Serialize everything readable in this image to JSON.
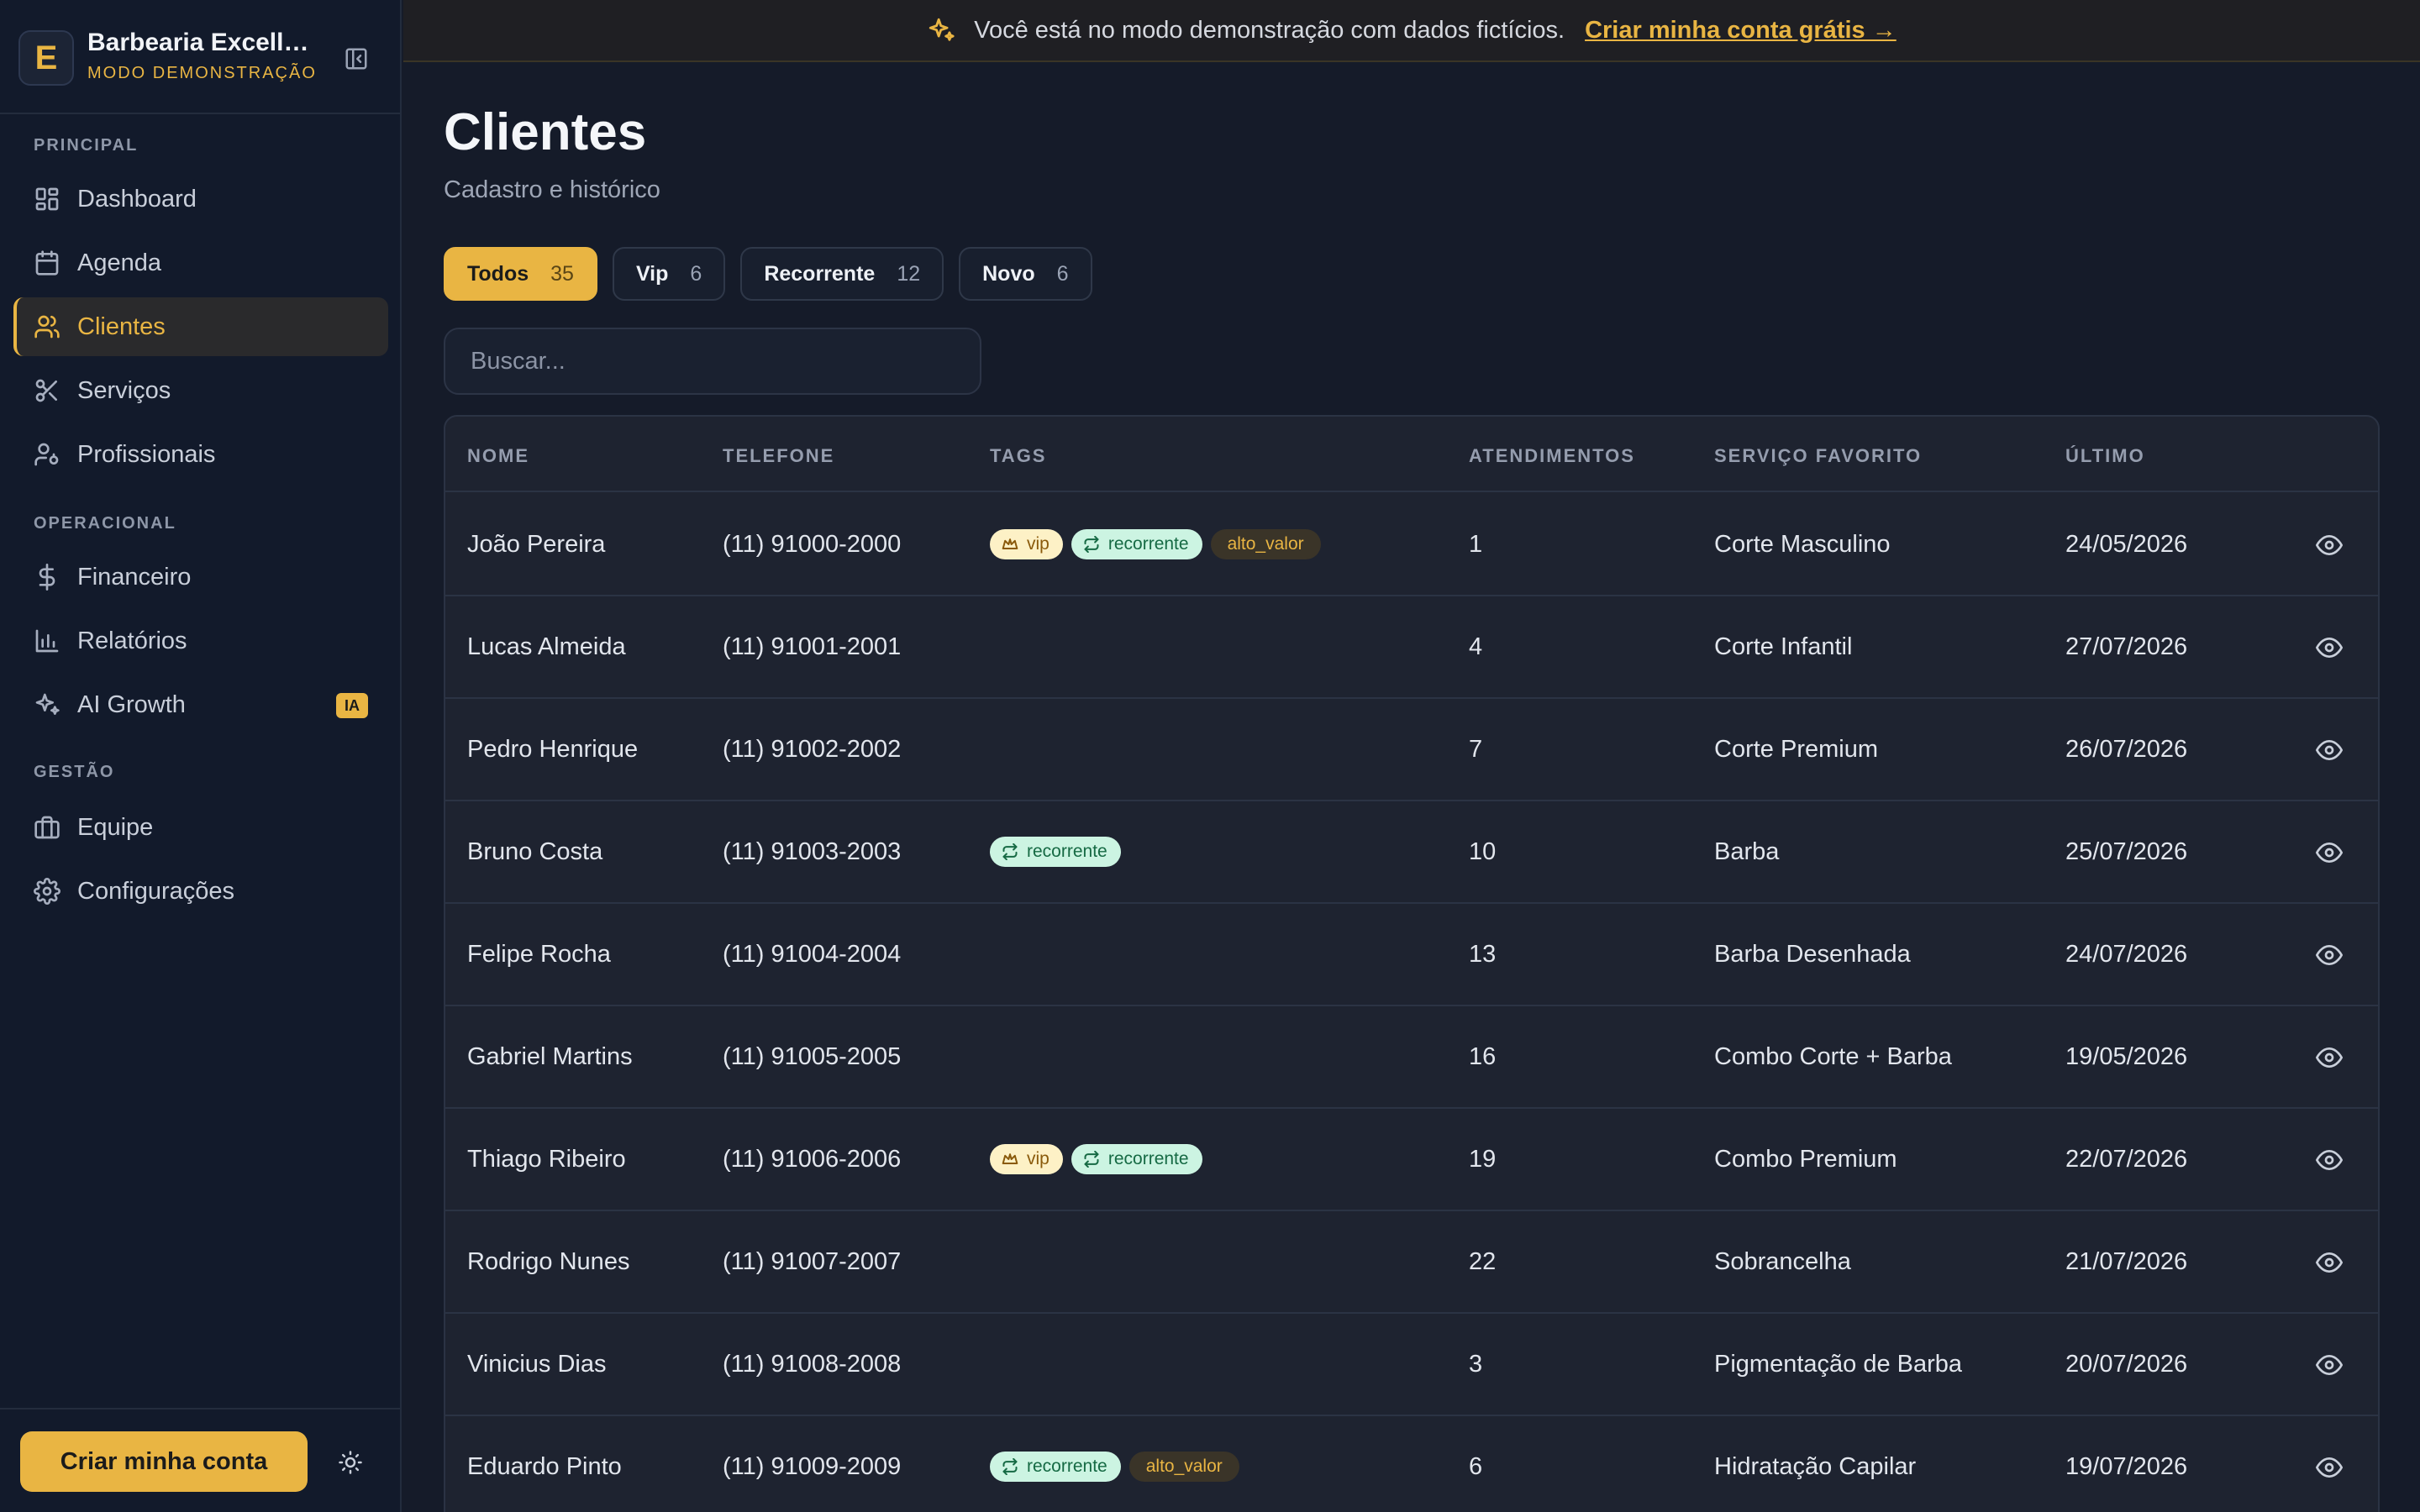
{
  "sidebar": {
    "brand": {
      "initial": "E",
      "name": "Barbearia Excellence",
      "mode": "MODO DEMONSTRAÇÃO"
    },
    "sections": {
      "principal": "PRINCIPAL",
      "operacional": "OPERACIONAL",
      "gestao": "GESTÃO"
    },
    "items": [
      {
        "label": "Dashboard",
        "icon": "dashboard-icon"
      },
      {
        "label": "Agenda",
        "icon": "calendar-icon"
      },
      {
        "label": "Clientes",
        "icon": "users-icon",
        "active": true
      },
      {
        "label": "Serviços",
        "icon": "scissors-icon"
      },
      {
        "label": "Profissionais",
        "icon": "professional-icon"
      },
      {
        "label": "Financeiro",
        "icon": "dollar-icon"
      },
      {
        "label": "Relatórios",
        "icon": "bar-chart-icon"
      },
      {
        "label": "AI Growth",
        "icon": "sparkles-icon",
        "badge": "IA"
      },
      {
        "label": "Equipe",
        "icon": "briefcase-icon"
      },
      {
        "label": "Configurações",
        "icon": "gear-icon"
      }
    ],
    "cta_label": "Criar minha conta"
  },
  "banner": {
    "text": "Você está no modo demonstração com dados fictícios.",
    "link": "Criar minha conta grátis →"
  },
  "page": {
    "title": "Clientes",
    "subtitle": "Cadastro e histórico"
  },
  "filters": [
    {
      "label": "Todos",
      "count": "35",
      "active": true
    },
    {
      "label": "Vip",
      "count": "6"
    },
    {
      "label": "Recorrente",
      "count": "12"
    },
    {
      "label": "Novo",
      "count": "6"
    }
  ],
  "search": {
    "placeholder": "Buscar..."
  },
  "table": {
    "headers": {
      "nome": "NOME",
      "telefone": "TELEFONE",
      "tags": "TAGS",
      "atendimentos": "ATENDIMENTOS",
      "servico": "SERVIÇO FAVORITO",
      "ultimo": "ÚLTIMO"
    },
    "rows": [
      {
        "nome": "João Pereira",
        "telefone": "(11) 91000-2000",
        "tags": [
          "vip",
          "recorrente",
          "alto_valor"
        ],
        "atendimentos": "1",
        "servico": "Corte Masculino",
        "ultimo": "24/05/2026"
      },
      {
        "nome": "Lucas Almeida",
        "telefone": "(11) 91001-2001",
        "tags": [],
        "atendimentos": "4",
        "servico": "Corte Infantil",
        "ultimo": "27/07/2026"
      },
      {
        "nome": "Pedro Henrique",
        "telefone": "(11) 91002-2002",
        "tags": [],
        "atendimentos": "7",
        "servico": "Corte Premium",
        "ultimo": "26/07/2026"
      },
      {
        "nome": "Bruno Costa",
        "telefone": "(11) 91003-2003",
        "tags": [
          "recorrente"
        ],
        "atendimentos": "10",
        "servico": "Barba",
        "ultimo": "25/07/2026"
      },
      {
        "nome": "Felipe Rocha",
        "telefone": "(11) 91004-2004",
        "tags": [],
        "atendimentos": "13",
        "servico": "Barba Desenhada",
        "ultimo": "24/07/2026"
      },
      {
        "nome": "Gabriel Martins",
        "telefone": "(11) 91005-2005",
        "tags": [],
        "atendimentos": "16",
        "servico": "Combo Corte + Barba",
        "ultimo": "19/05/2026"
      },
      {
        "nome": "Thiago Ribeiro",
        "telefone": "(11) 91006-2006",
        "tags": [
          "vip",
          "recorrente"
        ],
        "atendimentos": "19",
        "servico": "Combo Premium",
        "ultimo": "22/07/2026"
      },
      {
        "nome": "Rodrigo Nunes",
        "telefone": "(11) 91007-2007",
        "tags": [],
        "atendimentos": "22",
        "servico": "Sobrancelha",
        "ultimo": "21/07/2026"
      },
      {
        "nome": "Vinicius Dias",
        "telefone": "(11) 91008-2008",
        "tags": [],
        "atendimentos": "3",
        "servico": "Pigmentação de Barba",
        "ultimo": "20/07/2026"
      },
      {
        "nome": "Eduardo Pinto",
        "telefone": "(11) 91009-2009",
        "tags": [
          "recorrente",
          "alto_valor"
        ],
        "atendimentos": "6",
        "servico": "Hidratação Capilar",
        "ultimo": "19/07/2026"
      }
    ]
  },
  "colors": {
    "accent": "#e9b543",
    "background": "#151b29",
    "sidebar": "#121a2b",
    "tag_vip_bg": "#fdf1c6",
    "tag_recorrente_bg": "#ccf4e2"
  }
}
